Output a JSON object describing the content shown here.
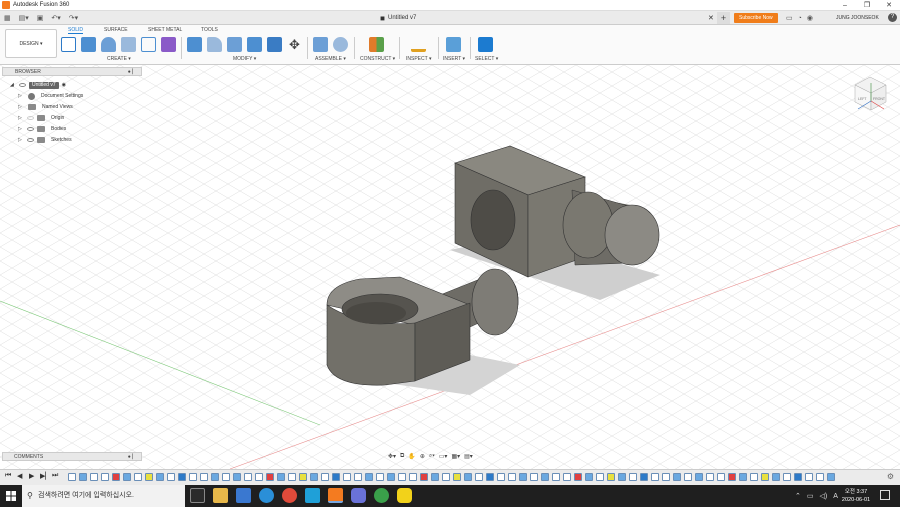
{
  "window": {
    "title": "Autodesk Fusion 360"
  },
  "tabbar": {
    "doc_title": "Untitled v7",
    "subscribe": "Subscribe Now",
    "user": "JUNG JOONSEOK"
  },
  "toolbar": {
    "workspace": "DESIGN ▾",
    "tabs": [
      "SOLID",
      "SURFACE",
      "SHEET METAL",
      "TOOLS"
    ],
    "groups": {
      "create": "CREATE ▾",
      "modify": "MODIFY ▾",
      "assemble": "ASSEMBLE ▾",
      "construct": "CONSTRUCT ▾",
      "inspect": "INSPECT ▾",
      "insert": "INSERT ▾",
      "select": "SELECT ▾"
    }
  },
  "browser": {
    "title": "BROWSER",
    "root": "Untitled v7",
    "items": [
      "Document Settings",
      "Named Views",
      "Origin",
      "Bodies",
      "Sketches"
    ]
  },
  "comments": {
    "title": "COMMENTS"
  },
  "viewcube": {
    "left": "LEFT",
    "front": "FRONT"
  },
  "taskbar": {
    "search_placeholder": "검색하려면 여기에 입력하십시오.",
    "time": "오전 3:37",
    "date": "2020-06-01"
  },
  "colors": {
    "accent": "#1c7bd0",
    "subscribe": "#f07d1a",
    "part": "#76746c"
  }
}
